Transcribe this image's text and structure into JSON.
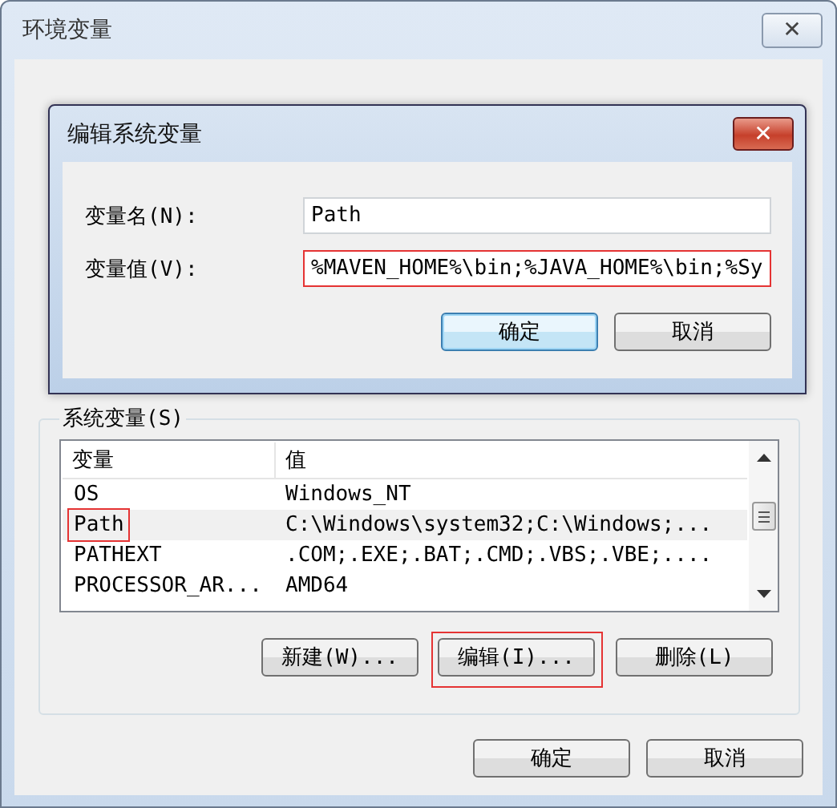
{
  "window": {
    "title": "环境变量",
    "close": "✕"
  },
  "dialog": {
    "title": "编辑系统变量",
    "close": "✕",
    "fields": [
      {
        "label": "变量名(N):",
        "value": "Path",
        "annotated": false
      },
      {
        "label": "变量值(V):",
        "value": "%MAVEN_HOME%\\bin;%JAVA_HOME%\\bin;%Sy",
        "annotated": true
      }
    ],
    "buttons": [
      {
        "label": "确定",
        "default": true
      },
      {
        "label": "取消",
        "default": false
      }
    ]
  },
  "system_variables": {
    "title": "系统变量(S)",
    "columns": [
      "变量",
      "值"
    ],
    "rows": [
      {
        "name": "OS",
        "value": "Windows_NT",
        "selected": false,
        "annotated": false
      },
      {
        "name": "Path",
        "value": "C:\\Windows\\system32;C:\\Windows;...",
        "selected": true,
        "annotated": true
      },
      {
        "name": "PATHEXT",
        "value": ".COM;.EXE;.BAT;.CMD;.VBS;.VBE;....",
        "selected": false,
        "annotated": false
      },
      {
        "name": "PROCESSOR_AR...",
        "value": "AMD64",
        "selected": false,
        "annotated": false
      }
    ],
    "buttons": [
      {
        "label": "新建(W)...",
        "annotated": false
      },
      {
        "label": "编辑(I)...",
        "annotated": true
      },
      {
        "label": "删除(L)",
        "annotated": false
      }
    ]
  },
  "buttons": [
    "确定",
    "取消"
  ]
}
